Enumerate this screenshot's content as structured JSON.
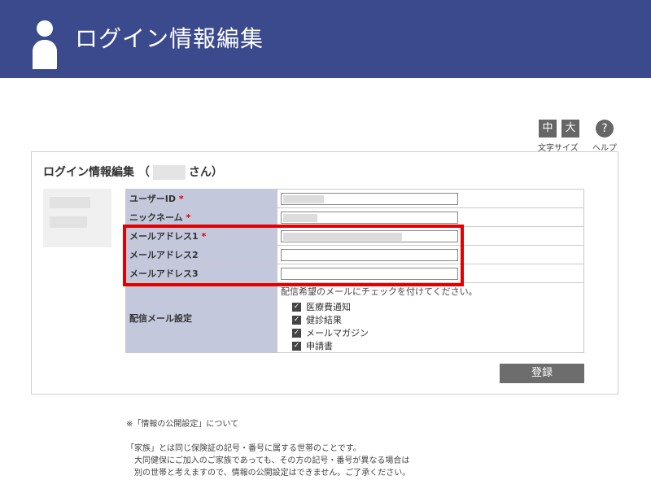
{
  "header": {
    "title": "ログイン情報編集",
    "icon": "user-icon"
  },
  "text_size": {
    "medium_label": "中",
    "large_label": "大",
    "caption": "文字サイズ"
  },
  "help": {
    "symbol": "?",
    "caption": "ヘルプ"
  },
  "panel": {
    "title_prefix": "ログイン情報編集 （",
    "title_suffix": "さん）"
  },
  "form": {
    "user_id": {
      "label": "ユーザーID",
      "required": "*"
    },
    "nickname": {
      "label": "ニックネーム",
      "required": "*"
    },
    "email1": {
      "label": "メールアドレス1",
      "required": "*"
    },
    "email2": {
      "label": "メールアドレス2",
      "value": ""
    },
    "email3": {
      "label": "メールアドレス3",
      "value": ""
    },
    "mail_settings": {
      "label": "配信メール設定",
      "notice": "配信希望のメールにチェックを付けてください。",
      "options": [
        {
          "label": "医療費通知",
          "checked": true
        },
        {
          "label": "健診結果",
          "checked": true
        },
        {
          "label": "メールマガジン",
          "checked": true
        },
        {
          "label": "申請書",
          "checked": true
        }
      ]
    },
    "submit_label": "登録"
  },
  "notes": {
    "heading": "※「情報の公開設定」について",
    "line1": "「家族」とは同じ保険証の記号・番号に属する世帯のことです。",
    "line2": "　大同健保にご加入のご家族であっても、その方の記号・番号が異なる場合は",
    "line3": "　別の世帯と考えますので、情報の公開設定はできません。ご了承ください。"
  },
  "colors": {
    "header": "#3a4a8c",
    "label_bg": "#c4c8dc",
    "highlight": "#e30000",
    "button": "#6d6d6d"
  }
}
